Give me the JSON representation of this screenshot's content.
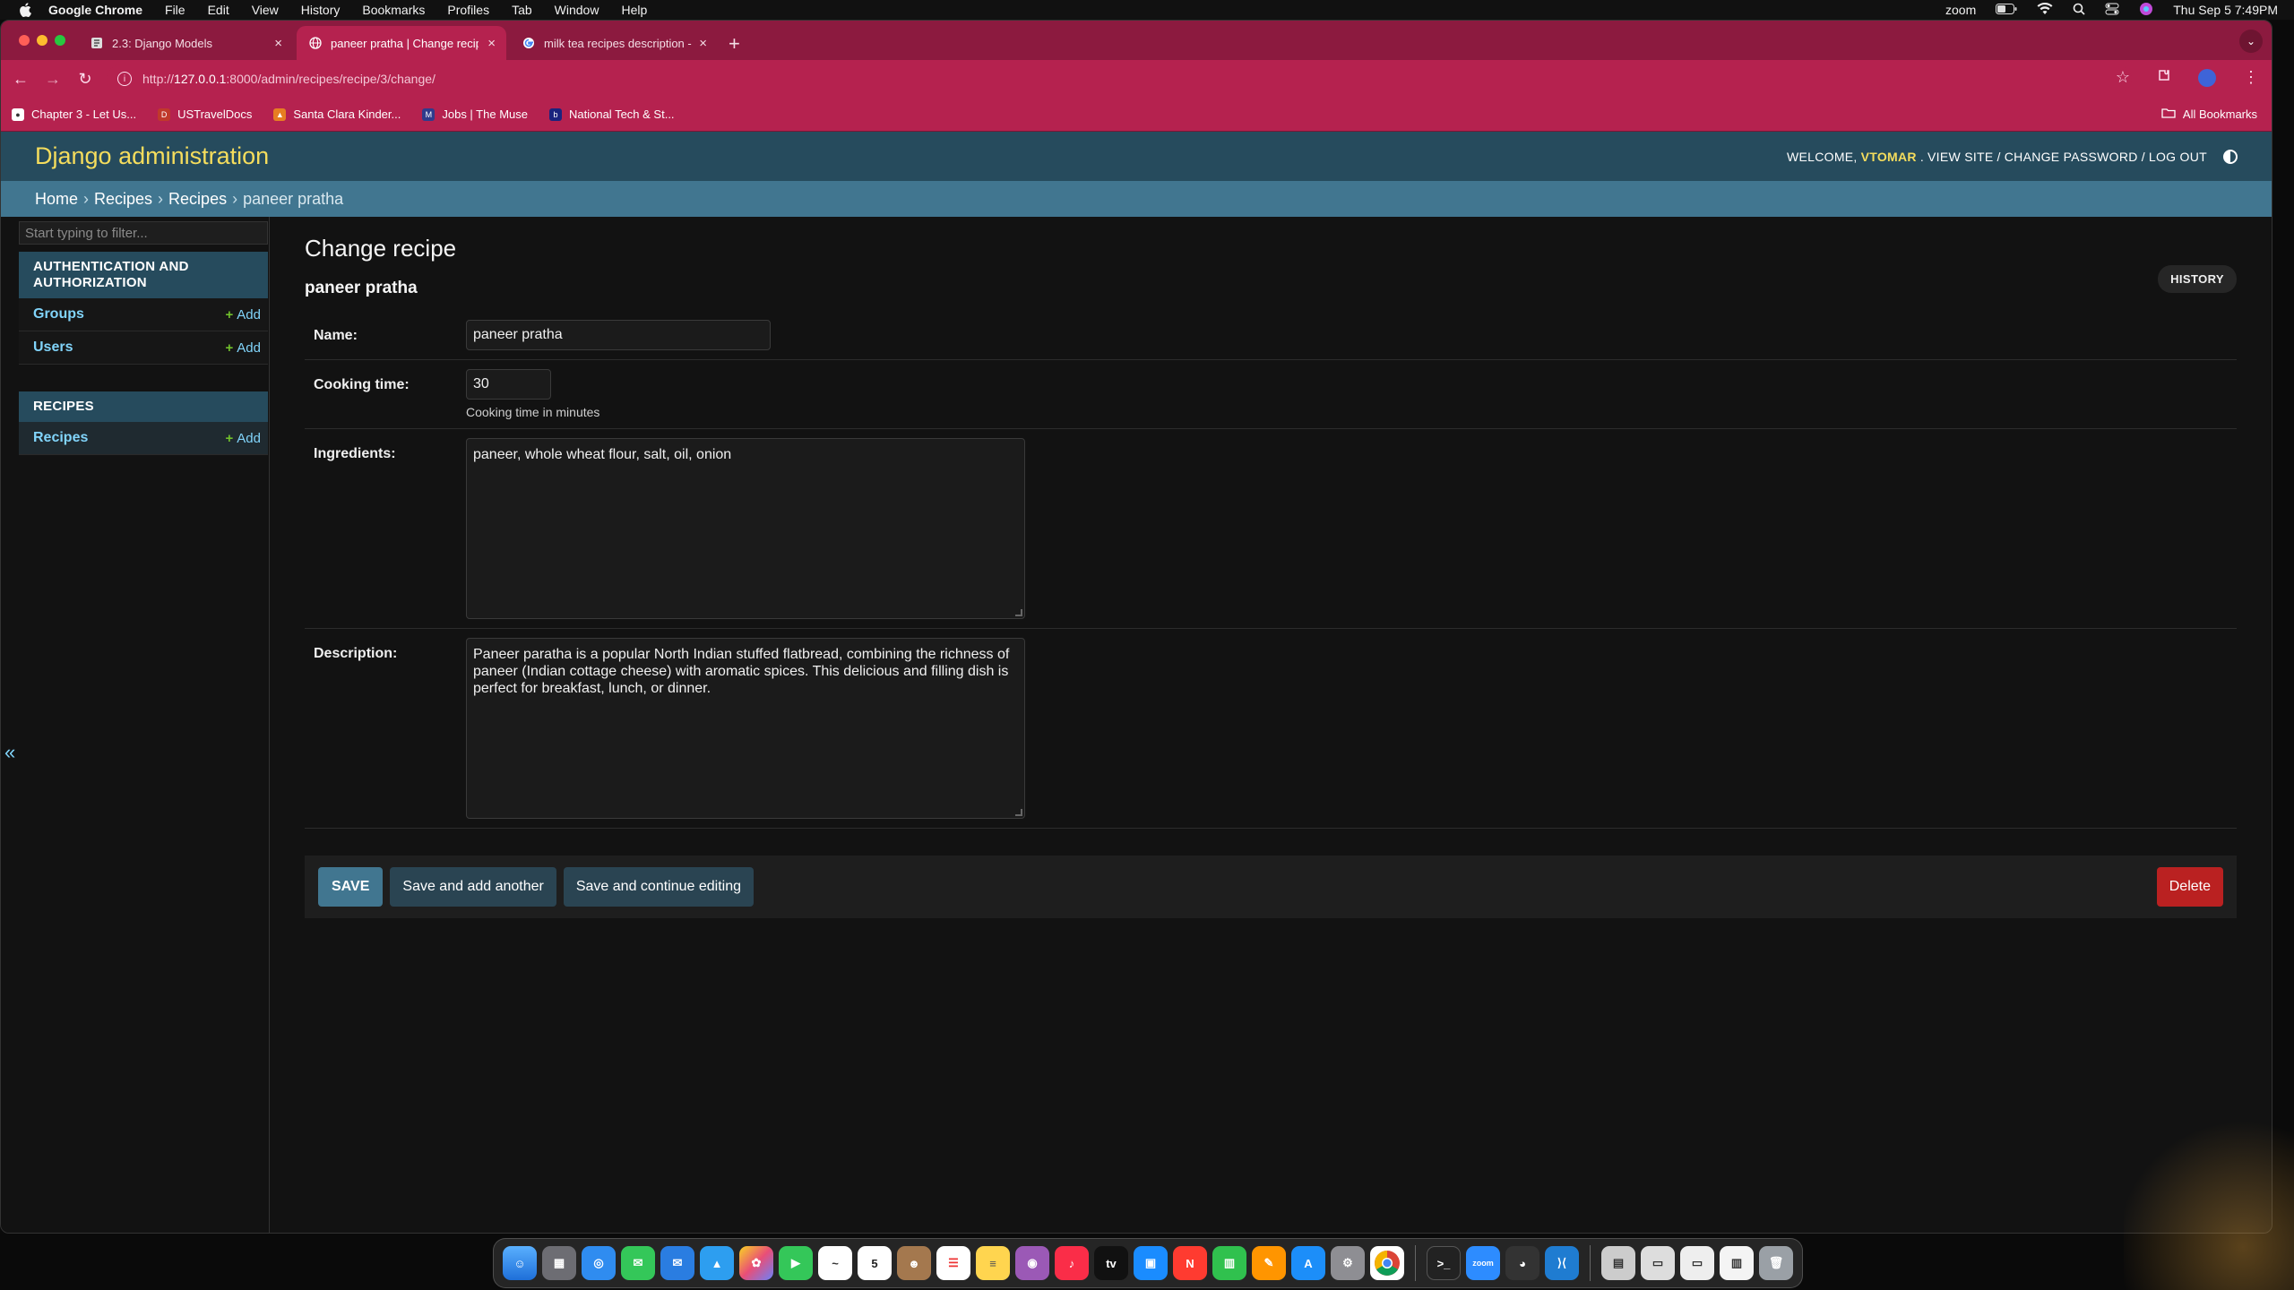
{
  "menubar": {
    "app": "Google Chrome",
    "items": [
      "File",
      "Edit",
      "View",
      "History",
      "Bookmarks",
      "Profiles",
      "Tab",
      "Window",
      "Help"
    ],
    "zoom": "zoom",
    "datetime": "Thu Sep 5  7:49PM"
  },
  "tabs": [
    {
      "title": "2.3: Django Models"
    },
    {
      "title": "paneer pratha | Change recipe"
    },
    {
      "title": "milk tea recipes description -"
    }
  ],
  "address": {
    "url_prefix": "http://",
    "url_host": "127.0.0.1",
    "url_rest": ":8000/admin/recipes/recipe/3/change/"
  },
  "bookmarks": [
    {
      "label": "Chapter 3 - Let Us..."
    },
    {
      "label": "USTravelDocs"
    },
    {
      "label": "Santa Clara Kinder..."
    },
    {
      "label": "Jobs | The Muse"
    },
    {
      "label": "National Tech & St..."
    }
  ],
  "all_bookmarks": "All Bookmarks",
  "django": {
    "brand": "Django administration",
    "welcome": "WELCOME,",
    "user": "VTOMAR",
    "view_site": "VIEW SITE",
    "change_password": "CHANGE PASSWORD",
    "log_out": "LOG OUT",
    "slash": " / ",
    "breadcrumbs": [
      "Home",
      "Recipes",
      "Recipes",
      "paneer pratha"
    ],
    "filter_placeholder": "Start typing to filter...",
    "modules": {
      "auth": {
        "caption": "AUTHENTICATION AND AUTHORIZATION",
        "rows": [
          {
            "label": "Groups",
            "add": "Add"
          },
          {
            "label": "Users",
            "add": "Add"
          }
        ]
      },
      "recipes": {
        "caption": "RECIPES",
        "rows": [
          {
            "label": "Recipes",
            "add": "Add"
          }
        ]
      }
    },
    "collapse": "«",
    "page_title": "Change recipe",
    "object_name": "paneer pratha",
    "history": "HISTORY",
    "fields": {
      "name": {
        "label": "Name:",
        "value": "paneer pratha"
      },
      "cooking_time": {
        "label": "Cooking time:",
        "value": "30",
        "help": "Cooking time in minutes"
      },
      "ingredients": {
        "label": "Ingredients:",
        "value": "paneer, whole wheat flour, salt, oil, onion"
      },
      "description": {
        "label": "Description:",
        "value": "Paneer paratha is a popular North Indian stuffed flatbread, combining the richness of paneer (Indian cottage cheese) with aromatic spices. This delicious and filling dish is perfect for breakfast, lunch, or dinner."
      }
    },
    "buttons": {
      "save": "SAVE",
      "save_add": "Save and add another",
      "save_continue": "Save and continue editing",
      "delete": "Delete"
    }
  },
  "dock": {
    "calendar_day": "5"
  },
  "colors": {
    "header": "#264b5d",
    "breadcrumbs": "#417690",
    "brand": "#f5dd5d",
    "link": "#81d4fa",
    "delete": "#ba2121",
    "chrome_tab": "#b5224f"
  }
}
